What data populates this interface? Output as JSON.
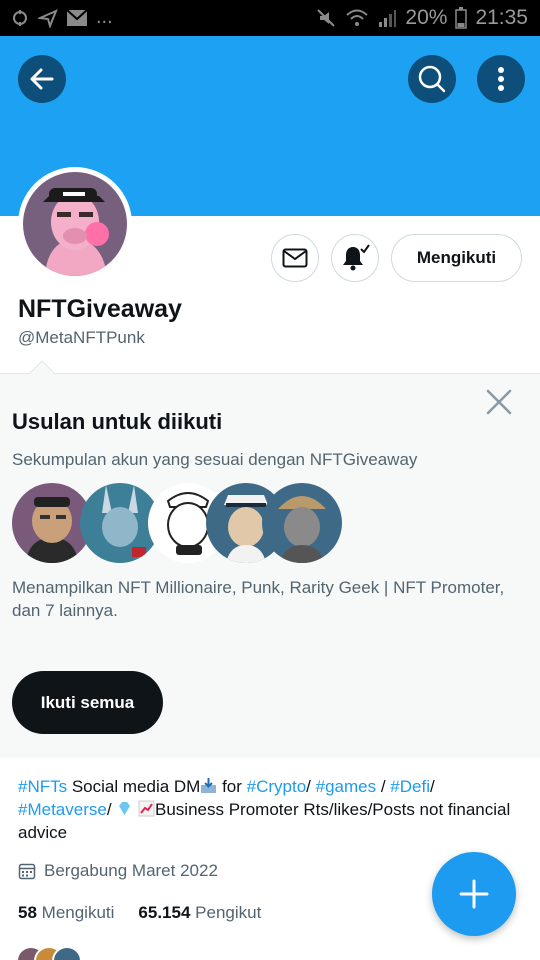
{
  "status_bar": {
    "battery": "20%",
    "time": "21:35",
    "notification_more": "..."
  },
  "profile": {
    "display_name": "NFTGiveaway",
    "handle": "@MetaNFTPunk",
    "following_button": "Mengikuti"
  },
  "suggestions": {
    "title": "Usulan untuk diikuti",
    "subtitle": "Sekumpulan akun yang sesuai dengan NFTGiveaway",
    "description": "Menampilkan NFT Millionaire, Punk, Rarity Geek | NFT Promoter, dan 7 lainnya.",
    "follow_all": "Ikuti semua"
  },
  "bio": {
    "tag_nfts": "#NFTs",
    "text_1": " Social media DM",
    "text_2": " for ",
    "tag_crypto": "#Crypto",
    "sep_1": "/ ",
    "tag_games": "#games",
    "sep_2": " / ",
    "tag_defi": "#Defi",
    "sep_3": "/ ",
    "tag_metaverse": "#Metaverse",
    "sep_4": "/ ",
    "text_3": "Business Promoter Rts/likes/Posts not financial advice"
  },
  "joined": "Bergabung Maret 2022",
  "stats": {
    "following_count": "58",
    "following_label": "Mengikuti",
    "followers_count": "65.154",
    "followers_label": "Pengikut"
  },
  "colors": {
    "banner": "#1da1f2",
    "accent": "#1d9bf0",
    "dark_button": "#0f1419",
    "header_button": "#0d4f7a"
  },
  "icons": {
    "back": "arrow-left-icon",
    "search": "search-icon",
    "more": "more-vertical-icon",
    "mail": "mail-icon",
    "bell": "bell-check-icon",
    "close": "close-icon",
    "calendar": "calendar-icon",
    "compose": "plus-icon"
  }
}
